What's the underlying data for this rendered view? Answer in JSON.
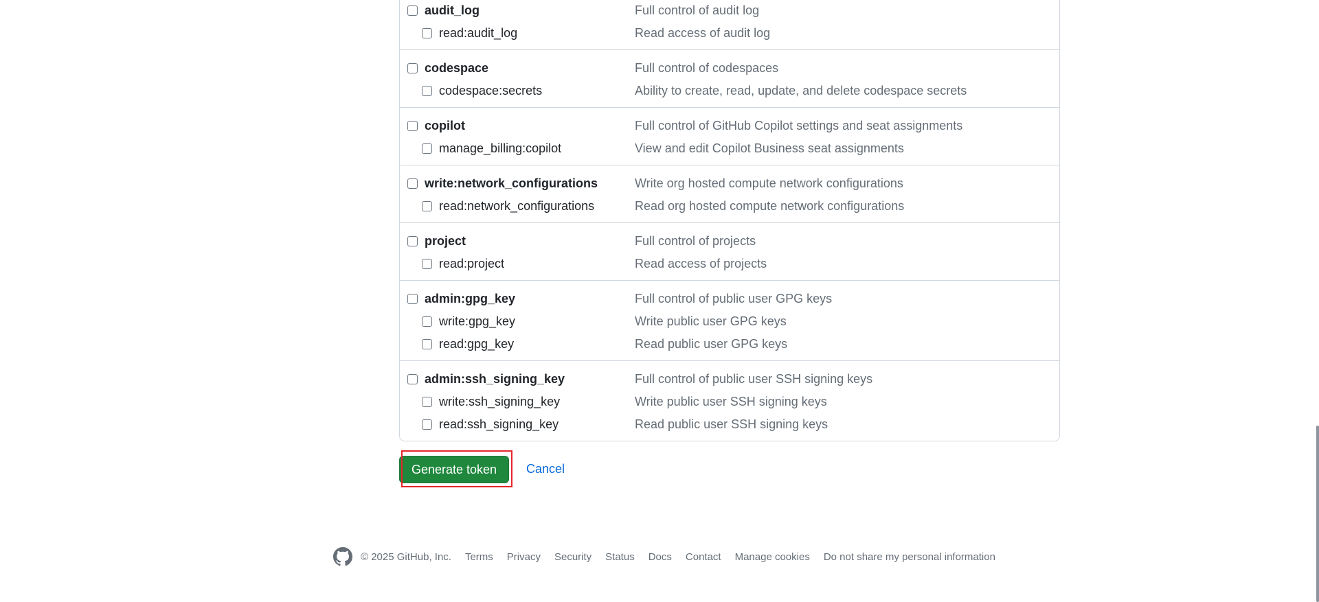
{
  "scopes": [
    {
      "name": "audit_log",
      "description": "Full control of audit log",
      "children": [
        {
          "name": "read:audit_log",
          "description": "Read access of audit log"
        }
      ]
    },
    {
      "name": "codespace",
      "description": "Full control of codespaces",
      "children": [
        {
          "name": "codespace:secrets",
          "description": "Ability to create, read, update, and delete codespace secrets"
        }
      ]
    },
    {
      "name": "copilot",
      "description": "Full control of GitHub Copilot settings and seat assignments",
      "children": [
        {
          "name": "manage_billing:copilot",
          "description": "View and edit Copilot Business seat assignments"
        }
      ]
    },
    {
      "name": "write:network_configurations",
      "description": "Write org hosted compute network configurations",
      "children": [
        {
          "name": "read:network_configurations",
          "description": "Read org hosted compute network configurations"
        }
      ]
    },
    {
      "name": "project",
      "description": "Full control of projects",
      "children": [
        {
          "name": "read:project",
          "description": "Read access of projects"
        }
      ]
    },
    {
      "name": "admin:gpg_key",
      "description": "Full control of public user GPG keys",
      "children": [
        {
          "name": "write:gpg_key",
          "description": "Write public user GPG keys"
        },
        {
          "name": "read:gpg_key",
          "description": "Read public user GPG keys"
        }
      ]
    },
    {
      "name": "admin:ssh_signing_key",
      "description": "Full control of public user SSH signing keys",
      "children": [
        {
          "name": "write:ssh_signing_key",
          "description": "Write public user SSH signing keys"
        },
        {
          "name": "read:ssh_signing_key",
          "description": "Read public user SSH signing keys"
        }
      ]
    }
  ],
  "actions": {
    "generate_label": "Generate token",
    "cancel_label": "Cancel"
  },
  "footer": {
    "copyright": "© 2025 GitHub, Inc.",
    "links": [
      "Terms",
      "Privacy",
      "Security",
      "Status",
      "Docs",
      "Contact",
      "Manage cookies",
      "Do not share my personal information"
    ],
    "logo_icon": "github-mark-icon"
  },
  "colors": {
    "primary_button": "#1f883d",
    "link": "#0969da",
    "highlight_outline": "#e5262b",
    "muted_text": "#656d76"
  }
}
